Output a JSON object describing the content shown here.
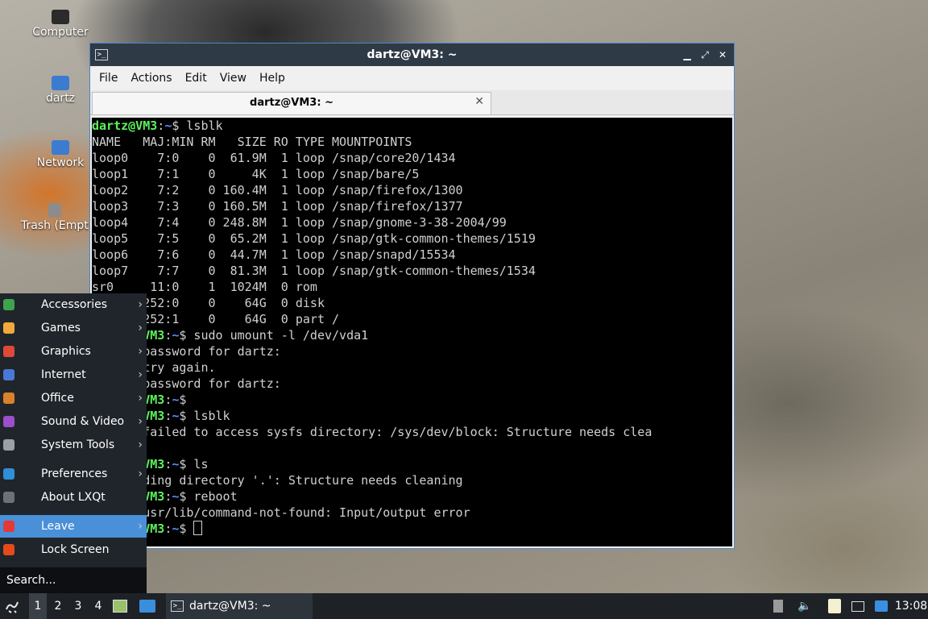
{
  "desktop": {
    "icons": [
      {
        "label": "Computer",
        "icon": "computer-icon"
      },
      {
        "label": "dartz",
        "icon": "home-folder-icon"
      },
      {
        "label": "Network",
        "icon": "network-icon"
      },
      {
        "label": "Trash (Empty)",
        "icon": "trash-icon"
      }
    ]
  },
  "window": {
    "title": "dartz@VM3: ~",
    "controls": {
      "minimize": "▁",
      "maximize": "⤢",
      "close": "✕"
    },
    "menus": [
      "File",
      "Actions",
      "Edit",
      "View",
      "Help"
    ],
    "tab": {
      "label": "dartz@VM3: ~",
      "close": "✕"
    }
  },
  "terminal": {
    "prompt_user": "dartz@VM3",
    "prompt_path": "~",
    "lines": [
      {
        "user": "dartz@VM3",
        "sep": ":",
        "path": "~",
        "rest": "$ lsblk"
      },
      {
        "text": "NAME   MAJ:MIN RM   SIZE RO TYPE MOUNTPOINTS"
      },
      {
        "text": "loop0    7:0    0  61.9M  1 loop /snap/core20/1434"
      },
      {
        "text": "loop1    7:1    0     4K  1 loop /snap/bare/5"
      },
      {
        "text": "loop2    7:2    0 160.4M  1 loop /snap/firefox/1300"
      },
      {
        "text": "loop3    7:3    0 160.5M  1 loop /snap/firefox/1377"
      },
      {
        "text": "loop4    7:4    0 248.8M  1 loop /snap/gnome-3-38-2004/99"
      },
      {
        "text": "loop5    7:5    0  65.2M  1 loop /snap/gtk-common-themes/1519"
      },
      {
        "text": "loop6    7:6    0  44.7M  1 loop /snap/snapd/15534"
      },
      {
        "text": "loop7    7:7    0  81.3M  1 loop /snap/gtk-common-themes/1534"
      },
      {
        "text": "sr0     11:0    1  1024M  0 rom"
      },
      {
        "text": "       252:0    0    64G  0 disk"
      },
      {
        "text": "       252:1    0    64G  0 part /"
      },
      {
        "user": "       ",
        "sep": "",
        "path": "",
        "rest": "",
        "tail_user": "VM3",
        "tail_sep": ":",
        "tail_path": "~",
        "tail_rest": "$ sudo umount -l /dev/vda1"
      },
      {
        "text": "       password for dartz:"
      },
      {
        "text": "       try again."
      },
      {
        "text": "       password for dartz:"
      },
      {
        "user": "       ",
        "sep": "",
        "path": "",
        "rest": "",
        "tail_user": "VM3",
        "tail_sep": ":",
        "tail_path": "~",
        "tail_rest": "$"
      },
      {
        "user": "       ",
        "sep": "",
        "path": "",
        "rest": "",
        "tail_user": "VM3",
        "tail_sep": ":",
        "tail_path": "~",
        "tail_rest": "$ lsblk"
      },
      {
        "text": "       failed to access sysfs directory: /sys/dev/block: Structure needs clea"
      },
      {
        "text": ""
      },
      {
        "user": "       ",
        "sep": "",
        "path": "",
        "rest": "",
        "tail_user": "VM3",
        "tail_sep": ":",
        "tail_path": "~",
        "tail_rest": "$ ls"
      },
      {
        "text": "       ding directory '.': Structure needs cleaning"
      },
      {
        "user": "       ",
        "sep": "",
        "path": "",
        "rest": "",
        "tail_user": "VM3",
        "tail_sep": ":",
        "tail_path": "~",
        "tail_rest": "$ reboot"
      },
      {
        "text": "       usr/lib/command-not-found: Input/output error"
      },
      {
        "user": "       ",
        "sep": "",
        "path": "",
        "rest": "",
        "tail_user": "VM3",
        "tail_sep": ":",
        "tail_path": "~",
        "tail_rest": "$ ",
        "cursor": true
      }
    ]
  },
  "start_menu": {
    "items": [
      {
        "label": "Accessories",
        "icon": "accessories-icon",
        "color": "#3fa34d",
        "submenu": true
      },
      {
        "label": "Games",
        "icon": "games-icon",
        "color": "#f2a93b",
        "submenu": true
      },
      {
        "label": "Graphics",
        "icon": "graphics-icon",
        "color": "#e0483a",
        "submenu": true
      },
      {
        "label": "Internet",
        "icon": "internet-icon",
        "color": "#4a78d6",
        "submenu": true
      },
      {
        "label": "Office",
        "icon": "office-icon",
        "color": "#d9822b",
        "submenu": true
      },
      {
        "label": "Sound & Video",
        "icon": "sound-video-icon",
        "color": "#9b4fc8",
        "submenu": true
      },
      {
        "label": "System Tools",
        "icon": "system-tools-icon",
        "color": "#9aa0a6",
        "submenu": true
      },
      {
        "label": "Preferences",
        "icon": "preferences-icon",
        "color": "#2f8fd8",
        "submenu": true
      },
      {
        "label": "About LXQt",
        "icon": "about-icon",
        "color": "#6b7178",
        "submenu": false
      },
      {
        "label": "Leave",
        "icon": "power-icon",
        "color": "#e53935",
        "submenu": true,
        "active": true
      },
      {
        "label": "Lock Screen",
        "icon": "lock-icon",
        "color": "#e64a19",
        "submenu": false
      }
    ],
    "search_placeholder": "Search..."
  },
  "taskbar": {
    "workspaces": [
      "1",
      "2",
      "3",
      "4"
    ],
    "current_workspace": "1",
    "task_label": "dartz@VM3: ~",
    "clock": "13:08"
  }
}
